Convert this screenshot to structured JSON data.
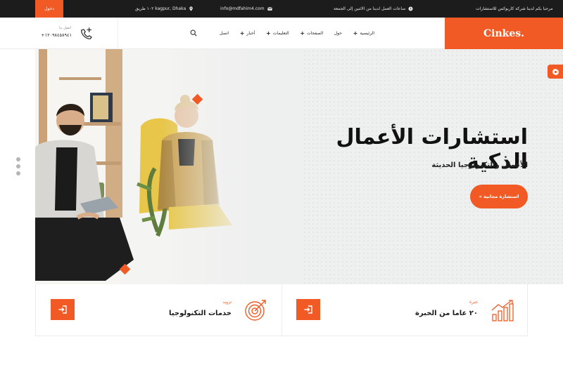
{
  "topbar": {
    "login_label": "دخول",
    "address": "١٠٢ طريق kagpur, Dhaka",
    "email": "info@mdfahim4.com",
    "hours": "ساعات العمل لدينا من الاثنين إلى الجمعة",
    "welcome": "مرحبا بكم لدينا شركة كاربوكس للاستشارات"
  },
  "header": {
    "phone_label": "اتصل بنا",
    "phone_number": "+١٢٠٩٨٤٥٨٩٤١",
    "logo": "Cinkes.",
    "nav": [
      {
        "label": "الرئيسية",
        "has_plus": true
      },
      {
        "label": "حول",
        "has_plus": false
      },
      {
        "label": "الصفحات",
        "has_plus": true
      },
      {
        "label": "التعليمات",
        "has_plus": true
      },
      {
        "label": "أخبار",
        "has_plus": true
      },
      {
        "label": "اتصل",
        "has_plus": false
      }
    ]
  },
  "hero": {
    "title": "استشارات الأعمال الذكية",
    "subtitle": "الأعمال والتكنولوجيا الحديثة",
    "cta": "استشارة مجانية »"
  },
  "cards": [
    {
      "kicker": "خبرة",
      "title": "٢٠ عاما من الخبرة",
      "icon": "chart-growth-icon"
    },
    {
      "kicker": "تزويد",
      "title": "خدمات التكنولوجيا",
      "icon": "target-icon"
    }
  ],
  "colors": {
    "accent": "#f15a24",
    "topbar": "#1c1c1c",
    "hero_bg": "#eeefef"
  }
}
